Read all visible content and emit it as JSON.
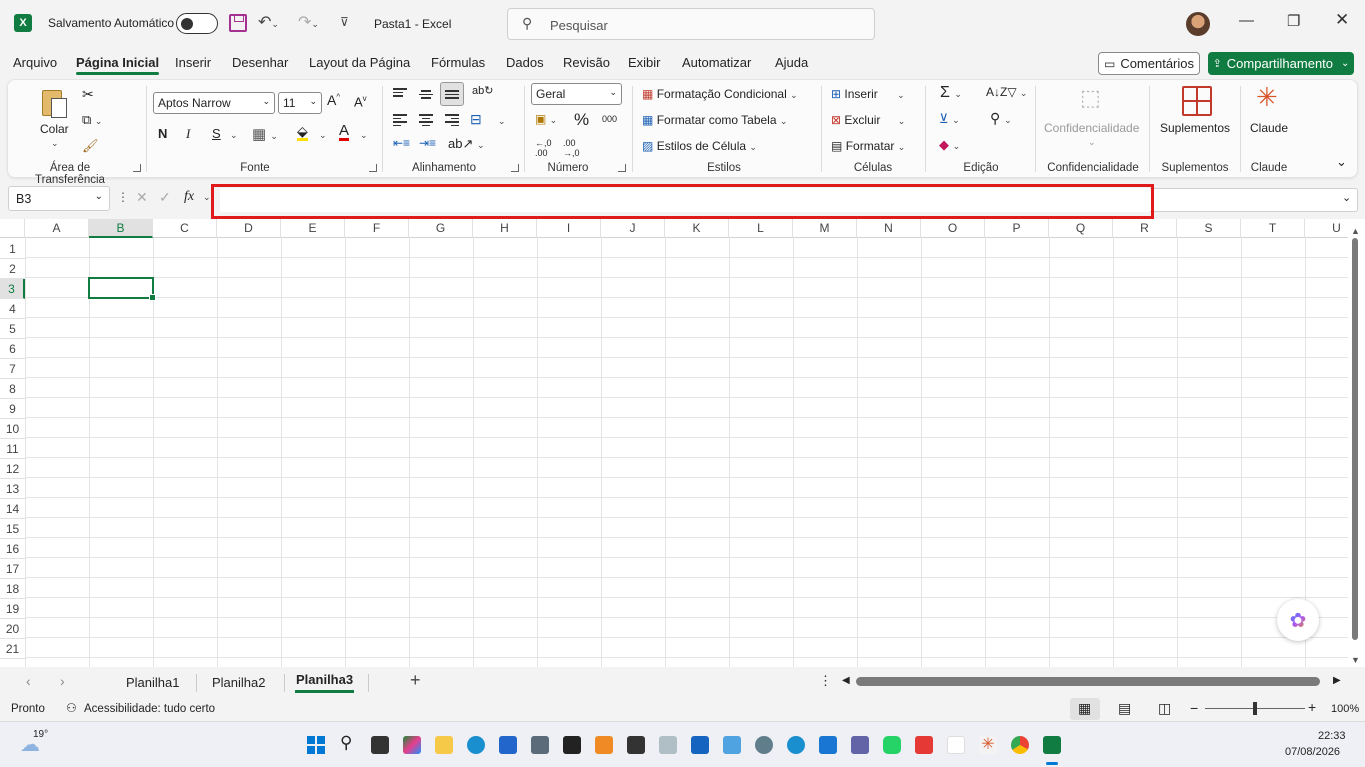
{
  "titlebar": {
    "autosave_label": "Salvamento Automático",
    "doc_title": "Pasta1  -  Excel",
    "search_placeholder": "Pesquisar"
  },
  "tabs": [
    "Arquivo",
    "Página Inicial",
    "Inserir",
    "Desenhar",
    "Layout da Página",
    "Fórmulas",
    "Dados",
    "Revisão",
    "Exibir",
    "Automatizar",
    "Ajuda"
  ],
  "active_tab": "Página Inicial",
  "actions": {
    "comments": "Comentários",
    "share": "Compartilhamento"
  },
  "ribbon": {
    "clipboard": {
      "paste": "Colar",
      "label": "Área de Transferência"
    },
    "font": {
      "name": "Aptos Narrow",
      "size": "11",
      "bold": "N",
      "italic": "I",
      "underline": "S",
      "label": "Fonte"
    },
    "alignment": {
      "label": "Alinhamento"
    },
    "number": {
      "format": "Geral",
      "label": "Número"
    },
    "styles": {
      "conditional": "Formatação Condicional",
      "as_table": "Formatar como Tabela",
      "cell_styles": "Estilos de Célula",
      "label": "Estilos"
    },
    "cells": {
      "insert": "Inserir",
      "delete": "Excluir",
      "format": "Formatar",
      "label": "Células"
    },
    "editing": {
      "label": "Edição"
    },
    "sensitivity": {
      "button": "Confidencialidade",
      "label": "Confidencialidade"
    },
    "addins": {
      "button": "Suplementos",
      "label": "Suplementos"
    },
    "claude": {
      "button": "Claude",
      "label": "Claude"
    }
  },
  "formula_bar": {
    "name_box": "B3",
    "fx": "fx",
    "value": ""
  },
  "grid": {
    "columns": [
      "A",
      "B",
      "C",
      "D",
      "E",
      "F",
      "G",
      "H",
      "I",
      "J",
      "K",
      "L",
      "M",
      "N",
      "O",
      "P",
      "Q",
      "R",
      "S",
      "T",
      "U"
    ],
    "rows": [
      "1",
      "2",
      "3",
      "4",
      "5",
      "6",
      "7",
      "8",
      "9",
      "10",
      "11",
      "12",
      "13",
      "14",
      "15",
      "16",
      "17",
      "18",
      "19",
      "20",
      "21"
    ],
    "active_cell": "B3"
  },
  "sheets": [
    "Planilha1",
    "Planilha2",
    "Planilha3"
  ],
  "active_sheet": "Planilha3",
  "status": {
    "ready": "Pronto",
    "accessibility": "Acessibilidade: tudo certo",
    "zoom": "100%"
  },
  "taskbar": {
    "weather": "19°",
    "time": "22:33",
    "date": "07/08/2026"
  },
  "colors": {
    "accent": "#107c41",
    "highlight": "#e01a1a"
  }
}
